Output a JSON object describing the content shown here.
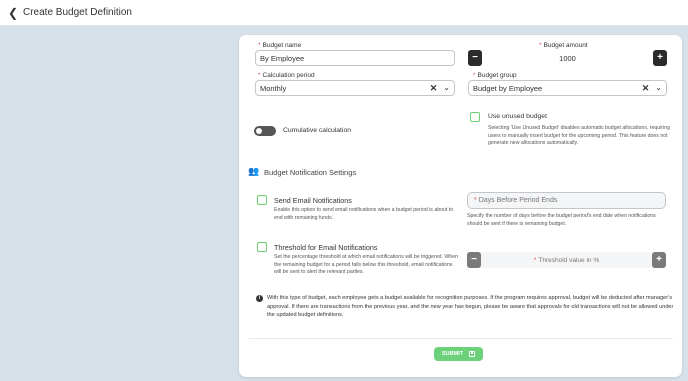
{
  "header": {
    "back_icon": "chevron-left-icon",
    "title": "Create Budget Definition"
  },
  "form": {
    "budget_name": {
      "label": "Budget name",
      "value": "By Employee"
    },
    "budget_amount": {
      "label": "Budget amount",
      "value": "1000",
      "decrement": "−",
      "increment": "+"
    },
    "calculation_period": {
      "label": "Calculation period",
      "value": "Monthly"
    },
    "budget_group": {
      "label": "Budget group",
      "value": "Budget by Employee"
    },
    "cumulative": {
      "label": "Cumulative calculation",
      "enabled": false
    },
    "use_unused": {
      "label": "Use unused budget",
      "checked": false,
      "description": "Selecting 'Use Unused Budget' disables automatic budget allocations, requiring users to manually insert budget for the upcoming period. This feature does not generate new allocations automatically."
    }
  },
  "notifications": {
    "section_title": "Budget Notification Settings",
    "section_icon": "users-icon",
    "send_email": {
      "label": "Send Email Notifications",
      "checked": false,
      "description": "Enable this option to send email notifications when a budget period is about to end with remaining funds.",
      "days_placeholder": "Days Before Period Ends",
      "days_description": "Specify the number of days before the budget period's end date when notifications should be sent if there is remaining budget."
    },
    "threshold": {
      "label": "Threshold for Email Notifications",
      "checked": false,
      "description": "Set the percentage threshold at which email notifications will be triggered. When the remaining budget for a period falls below this threshold, email notifications will be sent to alert the relevant parties.",
      "placeholder": "Threshold value in %"
    }
  },
  "info": {
    "icon": "info-icon",
    "text": "With this type of budget, each employee gets a budget available for recognition purposes. If the program requires approval, budget will be deducted after manager's approval. If there are transactions from the previous year, and the new year has begun, please be aware that approvals for old transactions will not be allowed under the updated budget definitions."
  },
  "actions": {
    "submit_label": "SUBMIT",
    "submit_icon": "save-icon"
  },
  "colors": {
    "accent_green": "#6dd07a",
    "required_red": "#e5534b",
    "page_bg": "#d7e1ea"
  }
}
